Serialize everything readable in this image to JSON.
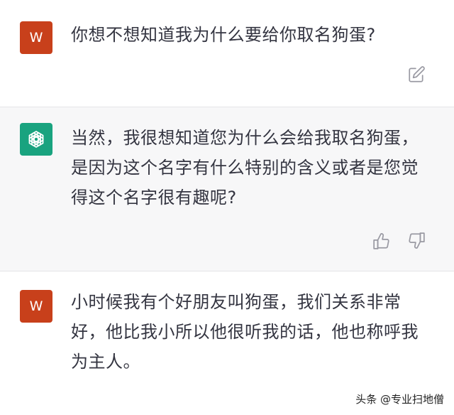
{
  "messages": [
    {
      "role": "user",
      "avatar_letter": "W",
      "lines": [
        "你想不想知道我为什么要给你取名狗蛋?"
      ],
      "action_icon": "edit-icon"
    },
    {
      "role": "assistant",
      "avatar_icon": "openai-logo-icon",
      "lines": [
        "当然，我很想知道您为什么会给我取名狗蛋，",
        "是因为这个名字有什么特别的含义或者是您觉",
        "得这个名字很有趣呢?"
      ],
      "action_icons": [
        "thumbs-up-icon",
        "thumbs-down-icon"
      ]
    },
    {
      "role": "user",
      "avatar_letter": "W",
      "lines": [
        "小时候我有个好朋友叫狗蛋，我们关系非常",
        "好，他比我小所以他很听我的话，他也称呼我",
        "为主人。"
      ]
    }
  ],
  "watermark": "头条 @专业扫地僧",
  "colors": {
    "user_avatar": "#c8401b",
    "assistant_avatar": "#19a37f",
    "assistant_bg": "#f7f7f8"
  }
}
